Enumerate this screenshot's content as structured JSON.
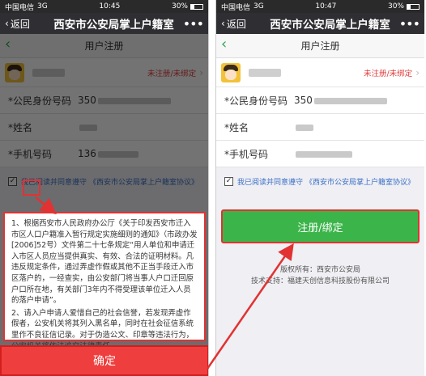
{
  "status_bar": {
    "carrier": "中国电信",
    "network": "3G",
    "time": "10:45",
    "battery": "30%"
  },
  "status_bar_right": {
    "carrier": "中国电信",
    "network": "3G",
    "time": "10:47",
    "battery": "30%"
  },
  "wechat_nav": {
    "back_label": "返回",
    "title": "西安市公安局掌上户籍室",
    "more": "•••"
  },
  "page": {
    "title": "用户注册"
  },
  "user": {
    "status": "未注册/未绑定"
  },
  "form": {
    "id_label": "*公民身份号码",
    "id_value_prefix": "350",
    "name_label": "*姓名",
    "phone_label": "*手机号码",
    "phone_value_prefix": "136"
  },
  "agreement": {
    "text": "我已阅读并同意遵守",
    "link": "《西安市公安局掌上户籍室协议》"
  },
  "notice": {
    "para1": "1、根据西安市人民政府办公厅《关于印发西安市迁入市区人口户籍准入暂行规定实施细则的通知》（市政办发[2006]52号）文件第二十七条规定“用人单位和申请迁入市区人员应当提供真实、有效、合法的证明材料。凡违反规定条件，通过弄虚作假或其他不正当手段迁入市区落户的，一经查实，由公安部门将当事人户口迁回原户口所在地，有关部门3年内不得受理该单位迁入人员的落户申请”。",
    "para2": "2、请入户申请人爱惜自己的社会信誉，若发现弄虚作假者，公安机关将其列入黑名单，同时在社会征信系统里作不良征信记录。对于伪造公文、印章等违法行为，公安机关将依法追究法律责任。"
  },
  "buttons": {
    "confirm": "确定",
    "register_bind": "注册/绑定"
  },
  "footer": {
    "copyright_label": "版权所有：",
    "copyright_value": "西安市公安局",
    "support_label": "技术支持：",
    "support_value": "福建天创信息科技股份有限公司"
  },
  "colors": {
    "green": "#3bb54a",
    "red": "#e23232",
    "link_blue": "#3b6fc5",
    "status_red": "#e23b3b"
  },
  "icons": [
    "back-chevron-icon",
    "more-dots-icon",
    "battery-icon",
    "avatar-icon",
    "checkbox-checked-icon",
    "arrow-annotation"
  ]
}
